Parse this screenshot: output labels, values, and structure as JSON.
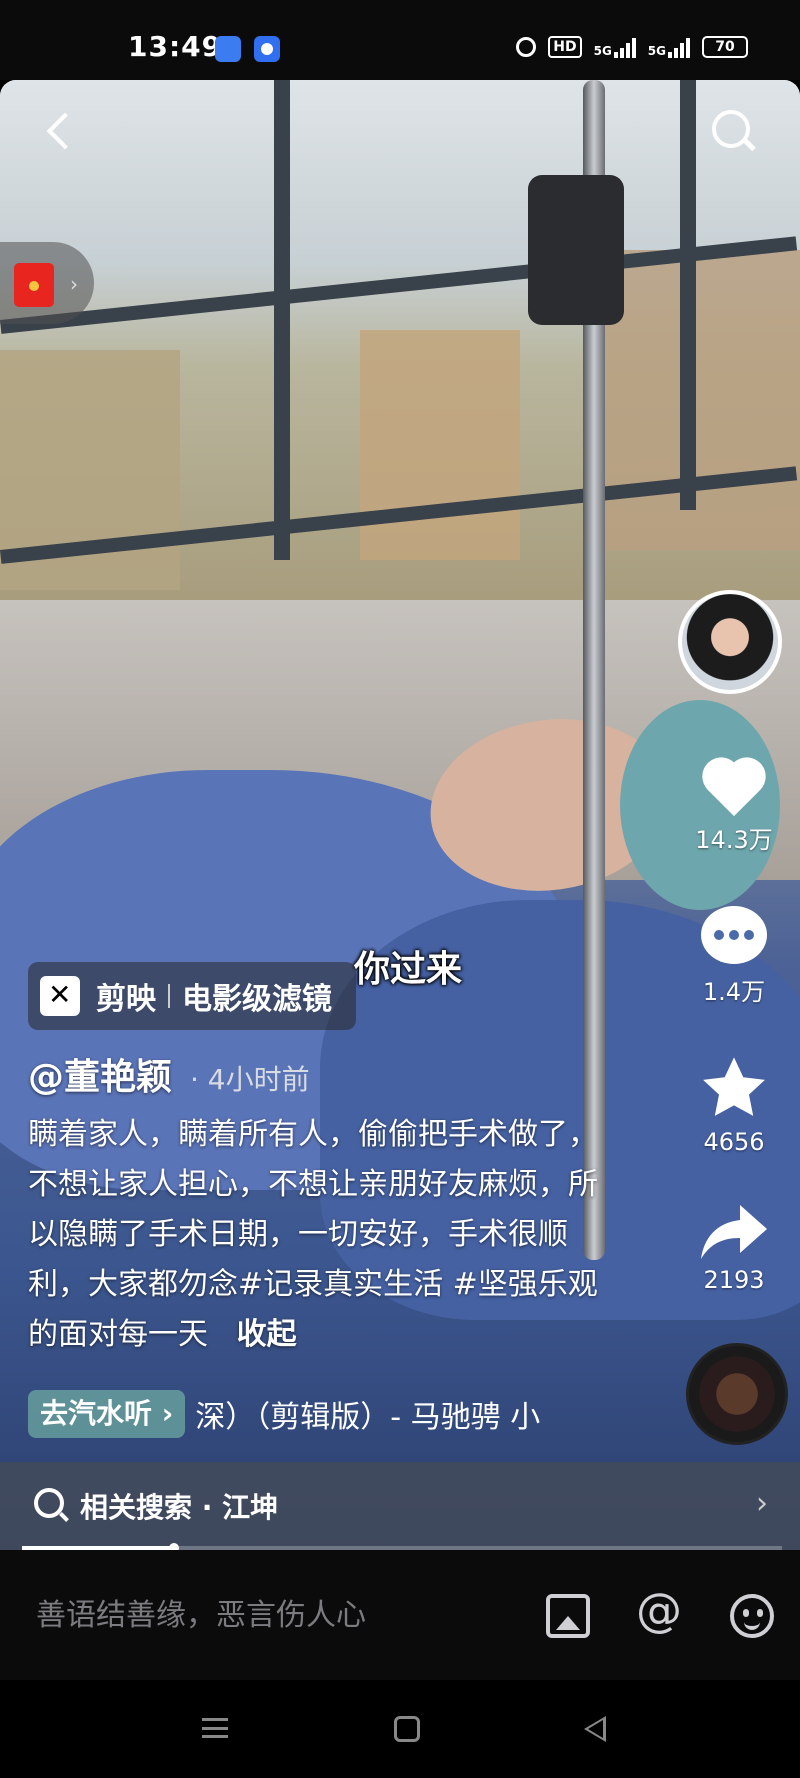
{
  "status_bar": {
    "time": "13:49",
    "hd_label": "HD",
    "network_1": "5G",
    "network_2": "5G",
    "battery": "70"
  },
  "video": {
    "subtitle": "你过来",
    "capcut": {
      "brand": "剪映",
      "tagline": "电影级滤镜"
    }
  },
  "post": {
    "author": "@董艳颖",
    "time_ago": "· 4小时前",
    "description": "瞒着家人，瞒着所有人，偷偷把手术做了，不想让家人担心，不想让亲朋好友麻烦，所以隐瞒了手术日期，一切安好，手术很顺利，大家都勿念#记录真实生活 #坚强乐观的面对每一天",
    "collapse_label": "收起"
  },
  "music": {
    "qishui_label": "去汽水听",
    "song_text": "深）（剪辑版）- 马驰骋  小"
  },
  "actions": {
    "likes": "14.3万",
    "comments": "1.4万",
    "favorites": "4656",
    "shares": "2193"
  },
  "related_search": {
    "label": "相关搜索 · 江坤"
  },
  "progress": {
    "fraction": 0.2
  },
  "comment_bar": {
    "placeholder": "善语结善缘，恶言伤人心"
  },
  "icons": [
    "back-icon",
    "search-icon",
    "red-packet-icon",
    "heart-icon",
    "comment-icon",
    "star-icon",
    "share-icon",
    "music-disc-icon",
    "image-icon",
    "at-icon",
    "emoji-icon",
    "menu-icon",
    "home-icon",
    "back-nav-icon"
  ]
}
